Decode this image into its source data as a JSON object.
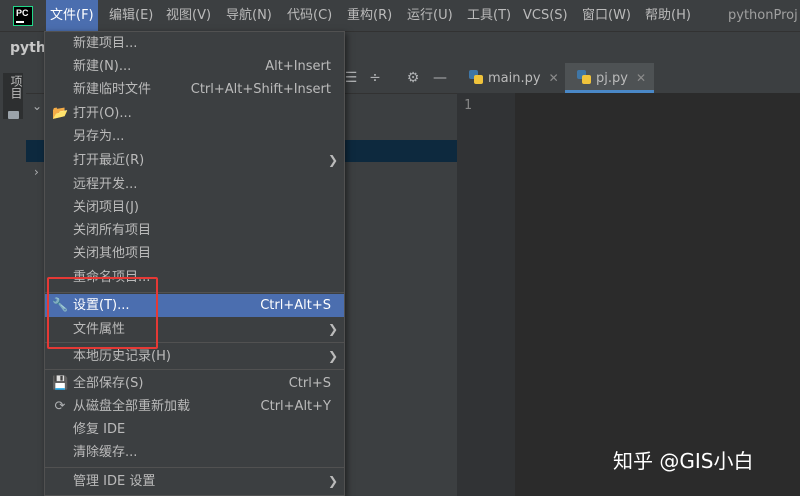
{
  "menubar": {
    "items": [
      "文件(F)",
      "编辑(E)",
      "视图(V)",
      "导航(N)",
      "代码(C)",
      "重构(R)",
      "运行(U)",
      "工具(T)",
      "VCS(S)",
      "窗口(W)",
      "帮助(H)"
    ],
    "project_title": "pythonProj"
  },
  "navbar": {
    "crumb": "pyth"
  },
  "tool_strip": {
    "project_tab": "项目"
  },
  "editor": {
    "tabs": [
      {
        "label": "main.py",
        "active": false
      },
      {
        "label": "pj.py",
        "active": true
      }
    ],
    "line_number": "1"
  },
  "file_menu": {
    "items": [
      {
        "label": "新建项目...",
        "shortcut": "",
        "submenu": false,
        "icon": ""
      },
      {
        "label": "新建(N)...",
        "shortcut": "Alt+Insert",
        "submenu": false,
        "icon": ""
      },
      {
        "label": "新建临时文件",
        "shortcut": "Ctrl+Alt+Shift+Insert",
        "submenu": false,
        "icon": ""
      },
      {
        "label": "打开(O)...",
        "shortcut": "",
        "submenu": false,
        "icon": "folder-open-icon"
      },
      {
        "label": "另存为...",
        "shortcut": "",
        "submenu": false,
        "icon": ""
      },
      {
        "label": "打开最近(R)",
        "shortcut": "",
        "submenu": true,
        "icon": ""
      },
      {
        "label": "远程开发...",
        "shortcut": "",
        "submenu": false,
        "icon": ""
      },
      {
        "label": "关闭项目(J)",
        "shortcut": "",
        "submenu": false,
        "icon": ""
      },
      {
        "label": "关闭所有项目",
        "shortcut": "",
        "submenu": false,
        "icon": ""
      },
      {
        "label": "关闭其他项目",
        "shortcut": "",
        "submenu": false,
        "icon": ""
      },
      {
        "label": "重命名项目...",
        "shortcut": "",
        "submenu": false,
        "icon": ""
      },
      {
        "label": "设置(T)...",
        "shortcut": "Ctrl+Alt+S",
        "submenu": false,
        "icon": "wrench-icon",
        "highlighted": true
      },
      {
        "label": "文件属性",
        "shortcut": "",
        "submenu": true,
        "icon": ""
      },
      {
        "label": "本地历史记录(H)",
        "shortcut": "",
        "submenu": true,
        "icon": ""
      },
      {
        "label": "全部保存(S)",
        "shortcut": "Ctrl+S",
        "submenu": false,
        "icon": "save-icon"
      },
      {
        "label": "从磁盘全部重新加载",
        "shortcut": "Ctrl+Alt+Y",
        "submenu": false,
        "icon": "reload-icon"
      },
      {
        "label": "修复 IDE",
        "shortcut": "",
        "submenu": false,
        "icon": ""
      },
      {
        "label": "清除缓存...",
        "shortcut": "",
        "submenu": false,
        "icon": ""
      },
      {
        "label": "管理 IDE 设置",
        "shortcut": "",
        "submenu": true,
        "icon": ""
      }
    ]
  },
  "watermark": "知乎 @GIS小白",
  "colors": {
    "highlight": "#4b6eaf",
    "annotation": "#e53935",
    "background": "#2b2b2b"
  }
}
